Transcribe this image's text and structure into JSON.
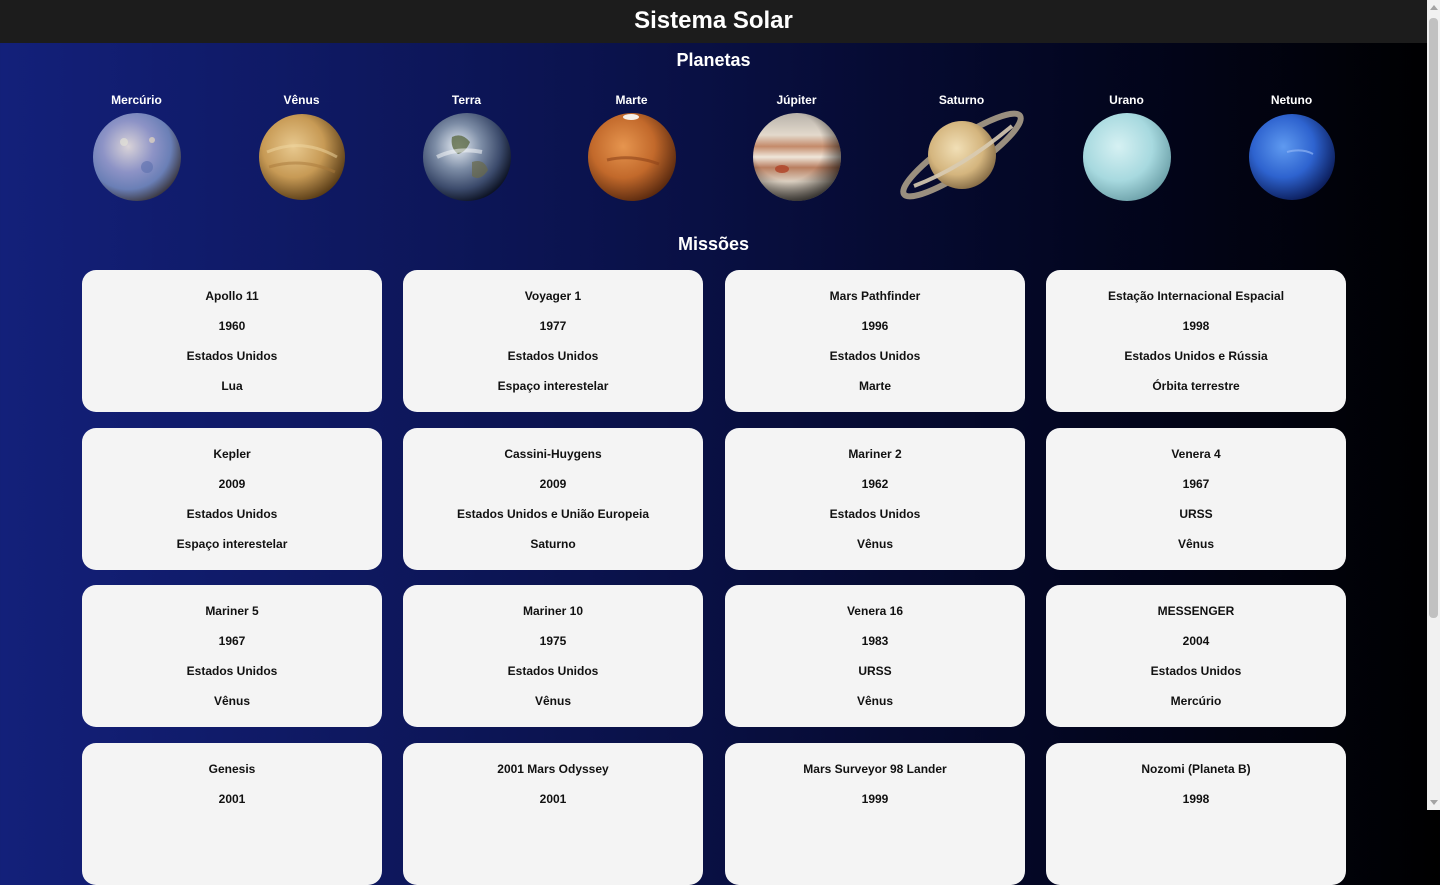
{
  "header": {
    "title": "Sistema Solar"
  },
  "planets_section": {
    "title": "Planetas",
    "planets": [
      {
        "name": "Mercúrio",
        "icon": "mercury-icon"
      },
      {
        "name": "Vênus",
        "icon": "venus-icon"
      },
      {
        "name": "Terra",
        "icon": "earth-icon"
      },
      {
        "name": "Marte",
        "icon": "mars-icon"
      },
      {
        "name": "Júpiter",
        "icon": "jupiter-icon"
      },
      {
        "name": "Saturno",
        "icon": "saturn-icon"
      },
      {
        "name": "Urano",
        "icon": "uranus-icon"
      },
      {
        "name": "Netuno",
        "icon": "neptune-icon"
      }
    ]
  },
  "missions_section": {
    "title": "Missões",
    "missions": [
      {
        "name": "Apollo 11",
        "year": "1960",
        "country": "Estados Unidos",
        "target": "Lua"
      },
      {
        "name": "Voyager 1",
        "year": "1977",
        "country": "Estados Unidos",
        "target": "Espaço interestelar"
      },
      {
        "name": "Mars Pathfinder",
        "year": "1996",
        "country": "Estados Unidos",
        "target": "Marte"
      },
      {
        "name": "Estação Internacional Espacial",
        "year": "1998",
        "country": "Estados Unidos e Rússia",
        "target": "Órbita terrestre"
      },
      {
        "name": "Kepler",
        "year": "2009",
        "country": "Estados Unidos",
        "target": "Espaço interestelar"
      },
      {
        "name": "Cassini-Huygens",
        "year": "2009",
        "country": "Estados Unidos e União Europeia",
        "target": "Saturno"
      },
      {
        "name": "Mariner 2",
        "year": "1962",
        "country": "Estados Unidos",
        "target": "Vênus"
      },
      {
        "name": "Venera 4",
        "year": "1967",
        "country": "URSS",
        "target": "Vênus"
      },
      {
        "name": "Mariner 5",
        "year": "1967",
        "country": "Estados Unidos",
        "target": "Vênus"
      },
      {
        "name": "Mariner 10",
        "year": "1975",
        "country": "Estados Unidos",
        "target": "Vênus"
      },
      {
        "name": "Venera 16",
        "year": "1983",
        "country": "URSS",
        "target": "Vênus"
      },
      {
        "name": "MESSENGER",
        "year": "2004",
        "country": "Estados Unidos",
        "target": "Mercúrio"
      },
      {
        "name": "Genesis",
        "year": "2001",
        "country": "",
        "target": ""
      },
      {
        "name": "2001 Mars Odyssey",
        "year": "2001",
        "country": "",
        "target": ""
      },
      {
        "name": "Mars Surveyor 98 Lander",
        "year": "1999",
        "country": "",
        "target": ""
      },
      {
        "name": "Nozomi (Planeta B)",
        "year": "1998",
        "country": "",
        "target": ""
      }
    ]
  }
}
